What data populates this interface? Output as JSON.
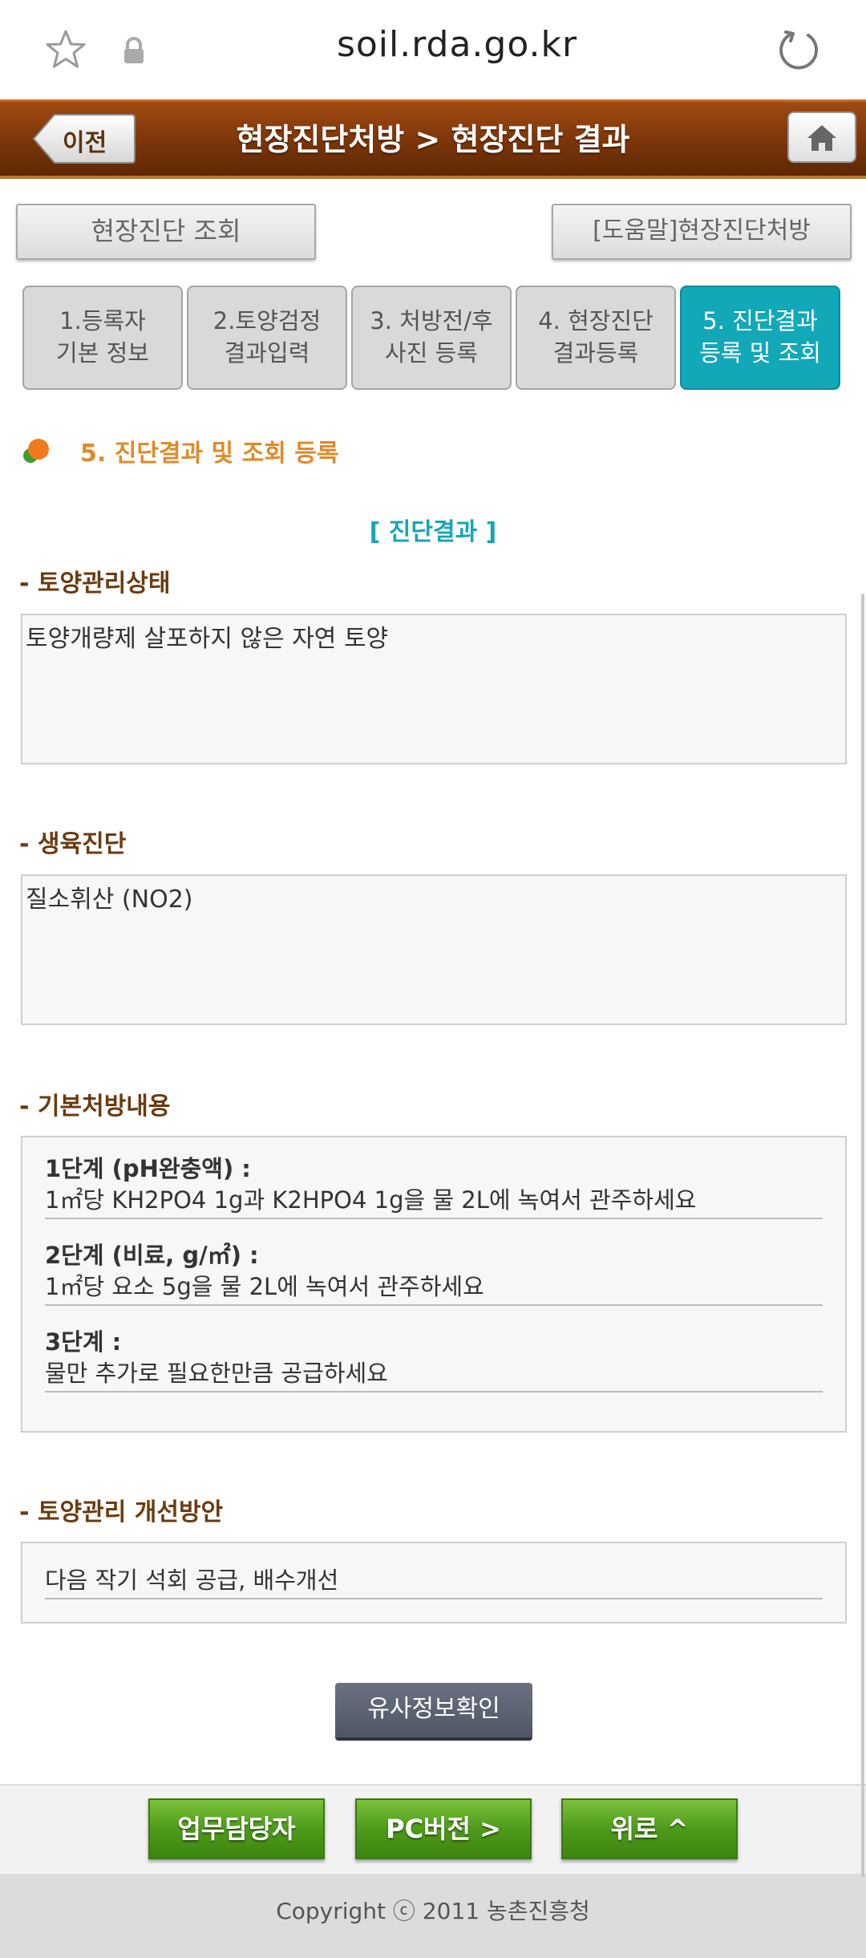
{
  "browser": {
    "url": "soil.rda.go.kr",
    "icons": [
      "star-icon",
      "lock-icon",
      "reload-icon"
    ]
  },
  "header": {
    "back_label": "이전",
    "title": "현장진단처방 > 현장진단 결과",
    "home_icon": "home-icon"
  },
  "top_buttons": {
    "query": "현장진단 조회",
    "help": "[도움말]현장진단처방"
  },
  "steps": [
    {
      "line1": "1.등록자",
      "line2": "기본 정보"
    },
    {
      "line1": "2.토양검정",
      "line2": "결과입력"
    },
    {
      "line1": "3. 처방전/후",
      "line2": "사진 등록"
    },
    {
      "line1": "4. 현장진단",
      "line2": "결과등록"
    },
    {
      "line1": "5. 진단결과",
      "line2": "등록 및 조회"
    }
  ],
  "active_step_index": 4,
  "section": {
    "heading": "5. 진단결과 및 조회 등록",
    "result_caption": "[ 진단결과 ]"
  },
  "soil_status": {
    "title": "- 토양관리상태",
    "value": "토양개량제 살포하지 않은 자연 토양"
  },
  "growth_diagnosis": {
    "title": "- 생육진단",
    "value": "질소휘산 (NO2)"
  },
  "prescription": {
    "title": "- 기본처방내용",
    "steps": [
      {
        "title": "1단계 (pH완충액) :",
        "text": "1㎡당 KH2PO4 1g과 K2HPO4 1g을 물 2L에 녹여서 관주하세요"
      },
      {
        "title": "2단계 (비료, g/㎡) :",
        "text": "1㎡당 요소 5g을 물 2L에 녹여서 관주하세요"
      },
      {
        "title": "3단계 :",
        "text": "물만 추가로 필요한만큼 공급하세요"
      }
    ]
  },
  "improvement": {
    "title": "- 토양관리 개선방안",
    "value": "다음 작기 석회 공급, 배수개선"
  },
  "similar_button": "유사정보확인",
  "bottom_nav": {
    "staff": "업무담당자",
    "pc": "PC버전 >",
    "top": "위로 ^"
  },
  "footer": {
    "copyright": "Copyright ⓒ 2011 농촌진흥청"
  },
  "colors": {
    "header": "#7b3509",
    "active_tab": "#12a8b8",
    "section_heading": "#e08a2a",
    "field_title": "#6b3b10",
    "nav_green": "#4e9a1a"
  }
}
